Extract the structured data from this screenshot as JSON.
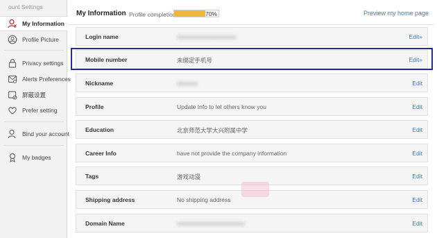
{
  "sidebar": {
    "heading": "ount Settings",
    "items": [
      {
        "label": "My Information",
        "icon": "user-icon",
        "active": true
      },
      {
        "label": "Profile Picture",
        "icon": "avatar-icon"
      },
      {
        "label": "Privacy settings",
        "icon": "lock-icon"
      },
      {
        "label": "Alerts Preferences",
        "icon": "alert-settings-icon"
      },
      {
        "label": "屏蔽设置",
        "icon": "block-icon"
      },
      {
        "label": "Prefer setting",
        "icon": "heart-icon"
      },
      {
        "label": "Bind your account",
        "icon": "bind-user-icon"
      },
      {
        "label": "My badges",
        "icon": "badge-icon"
      }
    ]
  },
  "header": {
    "title": "My Information",
    "completion_label": "Profile completion",
    "completion_value": "70%",
    "completion_fraction": 0.7,
    "preview_link": "Preview my home page"
  },
  "colors": {
    "accent": "#3a7abf",
    "progress": "#f0b63e",
    "highlight": "#1f2a9c",
    "active_icon": "#d33b3b"
  },
  "rows": [
    {
      "label": "Login name",
      "value": "",
      "edit": "Edit»"
    },
    {
      "label": "Mobile number",
      "value": "未绑定手机号",
      "edit": "Edit»"
    },
    {
      "label": "Nickname",
      "value": "",
      "edit": "Edit"
    },
    {
      "label": "Profile",
      "value": "Update Info to let others know you",
      "edit": "Edit"
    },
    {
      "label": "Education",
      "value": "北京师范大学大兴附属中学",
      "edit": "Edit"
    },
    {
      "label": "Career Info",
      "value": "have not provide the company information",
      "edit": "Edit"
    },
    {
      "label": "Tags",
      "value": "游戏动漫",
      "edit": "Edit"
    },
    {
      "label": "Shipping address",
      "value": "No shipping address",
      "edit": "Edit"
    },
    {
      "label": "Domain Name",
      "value": "",
      "edit": "Edit"
    }
  ]
}
